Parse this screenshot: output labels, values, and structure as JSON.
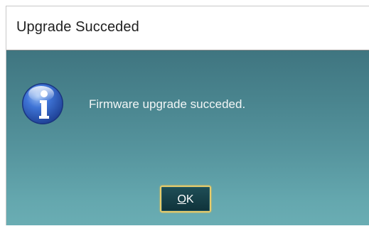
{
  "window": {
    "title": "Upgrade Succeded"
  },
  "dialog": {
    "icon": "information-icon",
    "message": "Firmware upgrade succeded.",
    "ok_button": {
      "mnemonic": "O",
      "rest": "K"
    }
  },
  "colors": {
    "dialog_background_top": "#3f7580",
    "dialog_background_bottom": "#6aadb3",
    "button_background": "#163f47",
    "button_focus_border": "#e9cc6a",
    "message_text": "#f2f6f6",
    "icon_blue": "#2f5fc4"
  }
}
